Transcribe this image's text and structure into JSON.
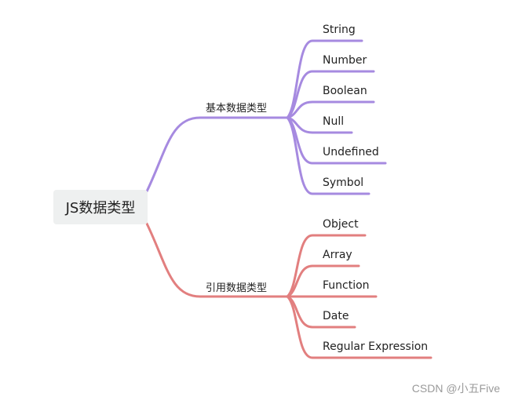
{
  "root": {
    "label": "JS数据类型"
  },
  "branches": [
    {
      "label": "基本数据类型",
      "color": "#a68ae0",
      "children": [
        "String",
        "Number",
        "Boolean",
        "Null",
        "Undefined",
        "Symbol"
      ]
    },
    {
      "label": "引用数据类型",
      "color": "#e27f7f",
      "children": [
        "Object",
        "Array",
        "Function",
        "Date",
        "Regular Expression"
      ]
    }
  ],
  "watermark": "CSDN @小五Five"
}
